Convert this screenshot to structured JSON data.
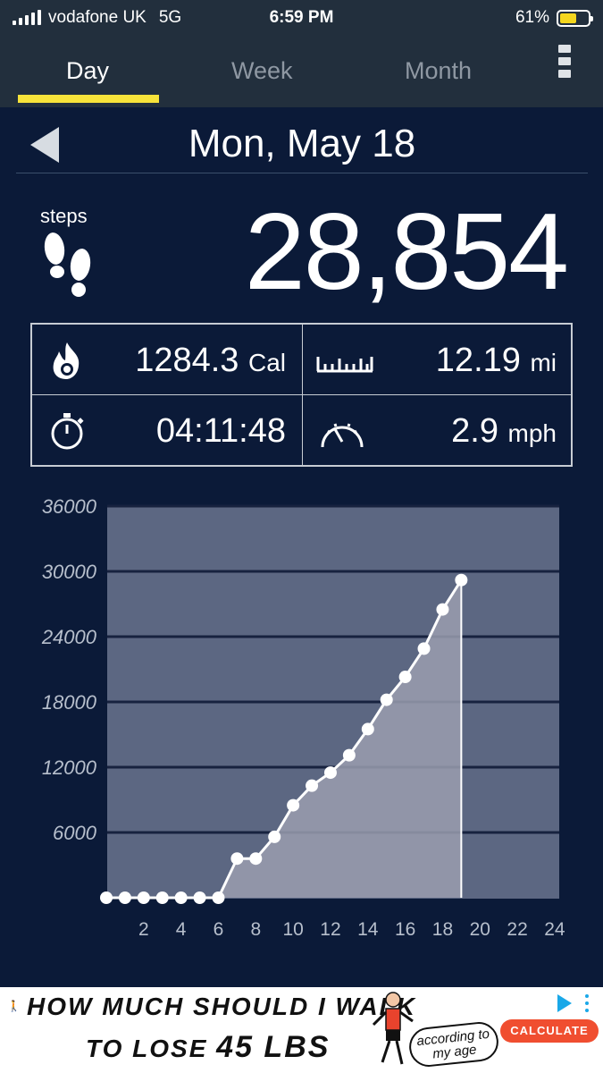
{
  "status_bar": {
    "carrier": "vodafone UK",
    "network": "5G",
    "time": "6:59 PM",
    "battery": "61%",
    "battery_level": 0.61
  },
  "tabs": [
    {
      "label": "Day",
      "active": true
    },
    {
      "label": "Week",
      "active": false
    },
    {
      "label": "Month",
      "active": false
    }
  ],
  "header": {
    "date": "Mon, May 18"
  },
  "steps": {
    "label": "steps",
    "value": "28,854"
  },
  "stats": {
    "calories": {
      "value": "1284.3",
      "unit": "Cal",
      "icon": "flame-icon"
    },
    "distance": {
      "value": "12.19",
      "unit": "mi",
      "icon": "ruler-icon"
    },
    "duration": {
      "value": "04:11:48",
      "icon": "stopwatch-icon"
    },
    "speed": {
      "value": "2.9",
      "unit": "mph",
      "icon": "speedometer-icon"
    }
  },
  "colors": {
    "accent": "#f7e33a",
    "background": "#0b1a38",
    "chart_panel": "#5c6782",
    "chart_fill": "#9a9eaf"
  },
  "chart_data": {
    "type": "area",
    "title": "",
    "xlabel": "",
    "ylabel": "",
    "x": [
      0,
      1,
      2,
      3,
      4,
      5,
      6,
      7,
      8,
      9,
      10,
      11,
      12,
      13,
      14,
      15,
      16,
      17,
      18,
      19
    ],
    "values": [
      0,
      0,
      0,
      0,
      0,
      0,
      0,
      3600,
      3600,
      5600,
      8500,
      10300,
      11500,
      13100,
      15500,
      18200,
      20300,
      22900,
      26500,
      29200
    ],
    "xticks": [
      "2",
      "4",
      "6",
      "8",
      "10",
      "12",
      "14",
      "16",
      "18",
      "20",
      "22",
      "24"
    ],
    "yticks": [
      "36000",
      "30000",
      "24000",
      "18000",
      "12000",
      "6000"
    ],
    "xlim": [
      0,
      24
    ],
    "ylim": [
      0,
      36000
    ],
    "grid": true
  },
  "ad": {
    "line1": "HOW MUCH SHOULD I WALK",
    "line2_prefix": "TO LOSE ",
    "line2_big": "45 LBS",
    "note": "according to my age",
    "cta": "CALCULATE"
  }
}
